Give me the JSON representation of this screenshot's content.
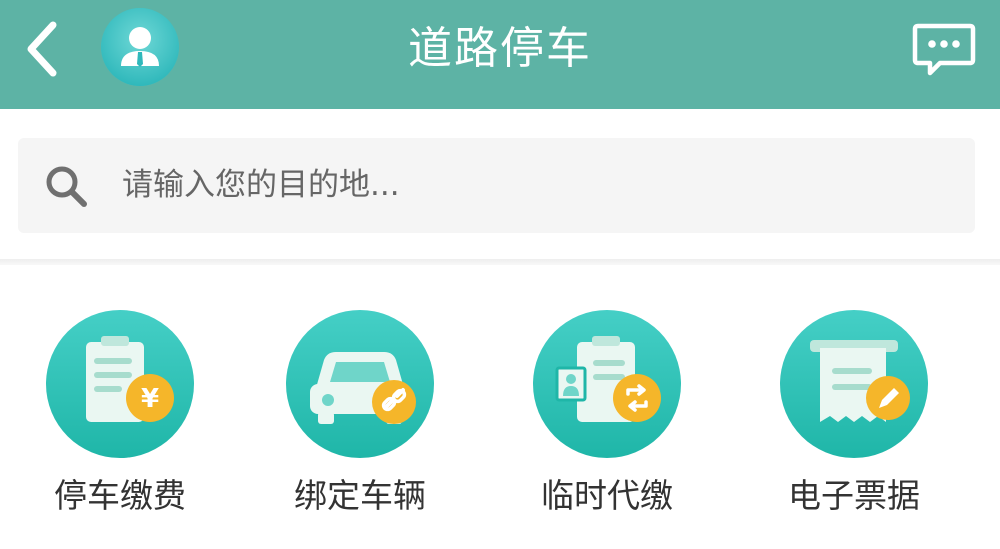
{
  "header": {
    "title": "道路停车",
    "back_icon": "chevron-left-icon",
    "avatar_icon": "user-avatar-icon",
    "message_icon": "message-bubble-icon"
  },
  "search": {
    "placeholder": "请输入您的目的地...",
    "icon": "search-icon"
  },
  "services": [
    {
      "label": "停车缴费",
      "icon": "parking-payment-icon"
    },
    {
      "label": "绑定车辆",
      "icon": "bind-vehicle-icon"
    },
    {
      "label": "临时代缴",
      "icon": "temporary-payment-icon"
    },
    {
      "label": "电子票据",
      "icon": "electronic-receipt-icon"
    }
  ],
  "colors": {
    "header": "#5db3a5",
    "icon_circle": "#33c8c0",
    "accent_badge": "#f5b62a"
  }
}
